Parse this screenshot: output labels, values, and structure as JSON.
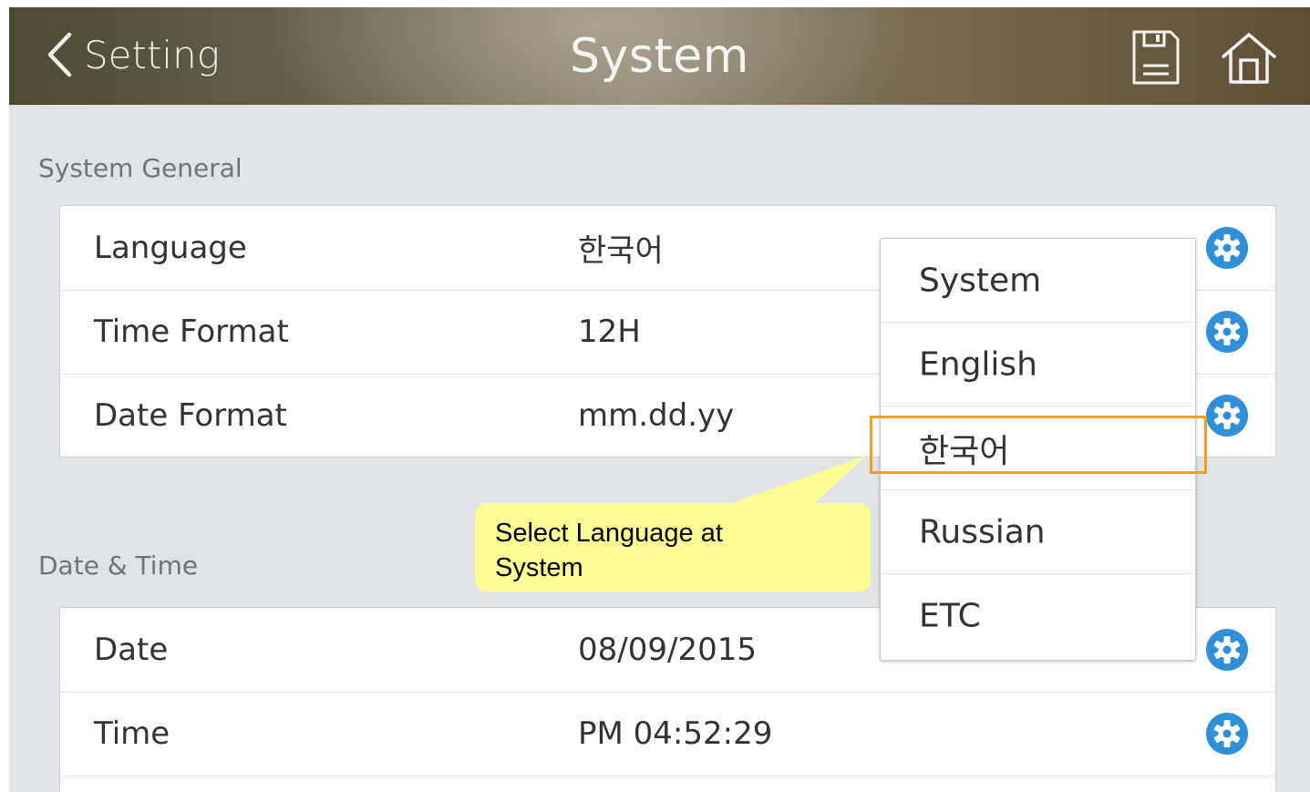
{
  "header": {
    "back_label": "Setting",
    "title": "System",
    "save_icon": "save-disk-icon",
    "home_icon": "home-icon"
  },
  "sections": [
    {
      "title": "System General",
      "rows": [
        {
          "label": "Language",
          "value": "한국어"
        },
        {
          "label": "Time Format",
          "value": "12H"
        },
        {
          "label": "Date Format",
          "value": "mm.dd.yy"
        }
      ]
    },
    {
      "title": "Date & Time",
      "rows": [
        {
          "label": "Date",
          "value": "08/09/2015"
        },
        {
          "label": "Time",
          "value": "PM 04:52:29"
        }
      ]
    }
  ],
  "language_dropdown": {
    "options": [
      "System",
      "English",
      "한국어",
      "Russian",
      "ETC"
    ],
    "selected": "한국어"
  },
  "callout": {
    "text_line1": "Select Language at",
    "text_line2": "System"
  },
  "colors": {
    "gear_blue": "#2f8fd8",
    "highlight_orange": "#f0a020",
    "callout_yellow": "#fdfd96"
  }
}
